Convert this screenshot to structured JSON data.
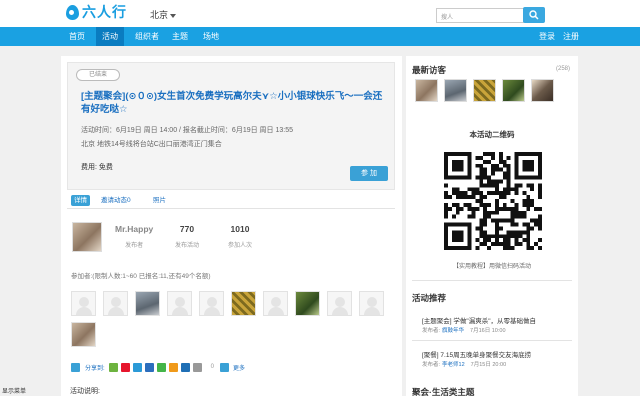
{
  "header": {
    "logo_text": "六人行",
    "city": "北京",
    "search_placeholder": "搜人"
  },
  "nav": {
    "items": [
      "首页",
      "活动",
      "组织者",
      "主题",
      "场地"
    ],
    "active_index": 1,
    "login": "登录",
    "register": "注册"
  },
  "event": {
    "status_badge": "已结束",
    "title": "[主题聚会](⊙０⊙)女生首次免费学玩高尔夫⋎☆小小银球快乐飞～一会还有好吃哒☆",
    "time": "活动时间：6月19日 周日 14:00 / 报名截止时间：6月19日 周日 13:55",
    "location": "北京 地铁14号线将台站C出口丽港湾正门集合",
    "fee": "费用: 免费",
    "join_label": "参 加"
  },
  "tabs": [
    "详情",
    "邀请动态0",
    "照片"
  ],
  "organizer": {
    "name": "Mr.Happy",
    "name_caption": "发布者",
    "published": "770",
    "published_caption": "发布活动",
    "joined": "1010",
    "joined_caption": "参加人次"
  },
  "participants_label": "参加者:(限制人数:1~60 已报名:11,还有49个名额)",
  "share": {
    "label": "分享到:",
    "count": "0",
    "more": "更多"
  },
  "description_label": "活动说明:",
  "bottom_left": "显示菜单",
  "sidebar": {
    "visitors_title": "最新访客",
    "visitors_count": "(258)",
    "qr_title": "本活动二维码",
    "qr_caption": "【实用教程】用微信扫码活动",
    "recommend_title": "活动推荐",
    "recommendations": [
      {
        "title": "[主题聚会] 学做\"漏爽杀\"，从零基础做自",
        "author_label": "发布者:",
        "author": "旗鼓年华",
        "date": "7月16日 10:00"
      },
      {
        "title": "[聚餐] 7.15周五晚单身聚餐交友海底捞",
        "author_label": "发布者:",
        "author": "李老师12",
        "date": "7月15日 20:00"
      }
    ],
    "bottom_title": "聚会·生活类主题"
  },
  "colors": {
    "brand_blue": "#1aa1e2",
    "nav_active": "#0a7cc0",
    "link_blue": "#1a6fc0"
  }
}
